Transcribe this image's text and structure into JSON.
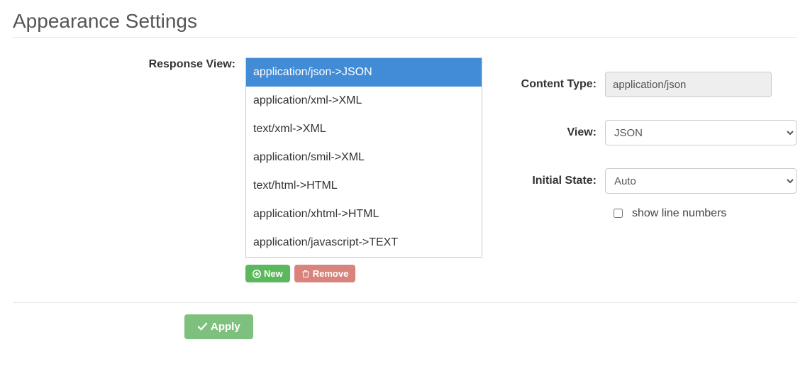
{
  "page_title": "Appearance Settings",
  "labels": {
    "response_view": "Response View:",
    "content_type": "Content Type:",
    "view": "View:",
    "initial_state": "Initial State:",
    "show_line_numbers": "show line numbers"
  },
  "buttons": {
    "new": "New",
    "remove": "Remove",
    "apply": "Apply"
  },
  "response_view_items": [
    "application/json->JSON",
    "application/xml->XML",
    "text/xml->XML",
    "application/smil->XML",
    "text/html->HTML",
    "application/xhtml->HTML",
    "application/javascript->TEXT"
  ],
  "selected_index": 0,
  "fields": {
    "content_type_value": "application/json",
    "view_value": "JSON",
    "initial_state_value": "Auto"
  },
  "show_line_numbers_checked": false
}
